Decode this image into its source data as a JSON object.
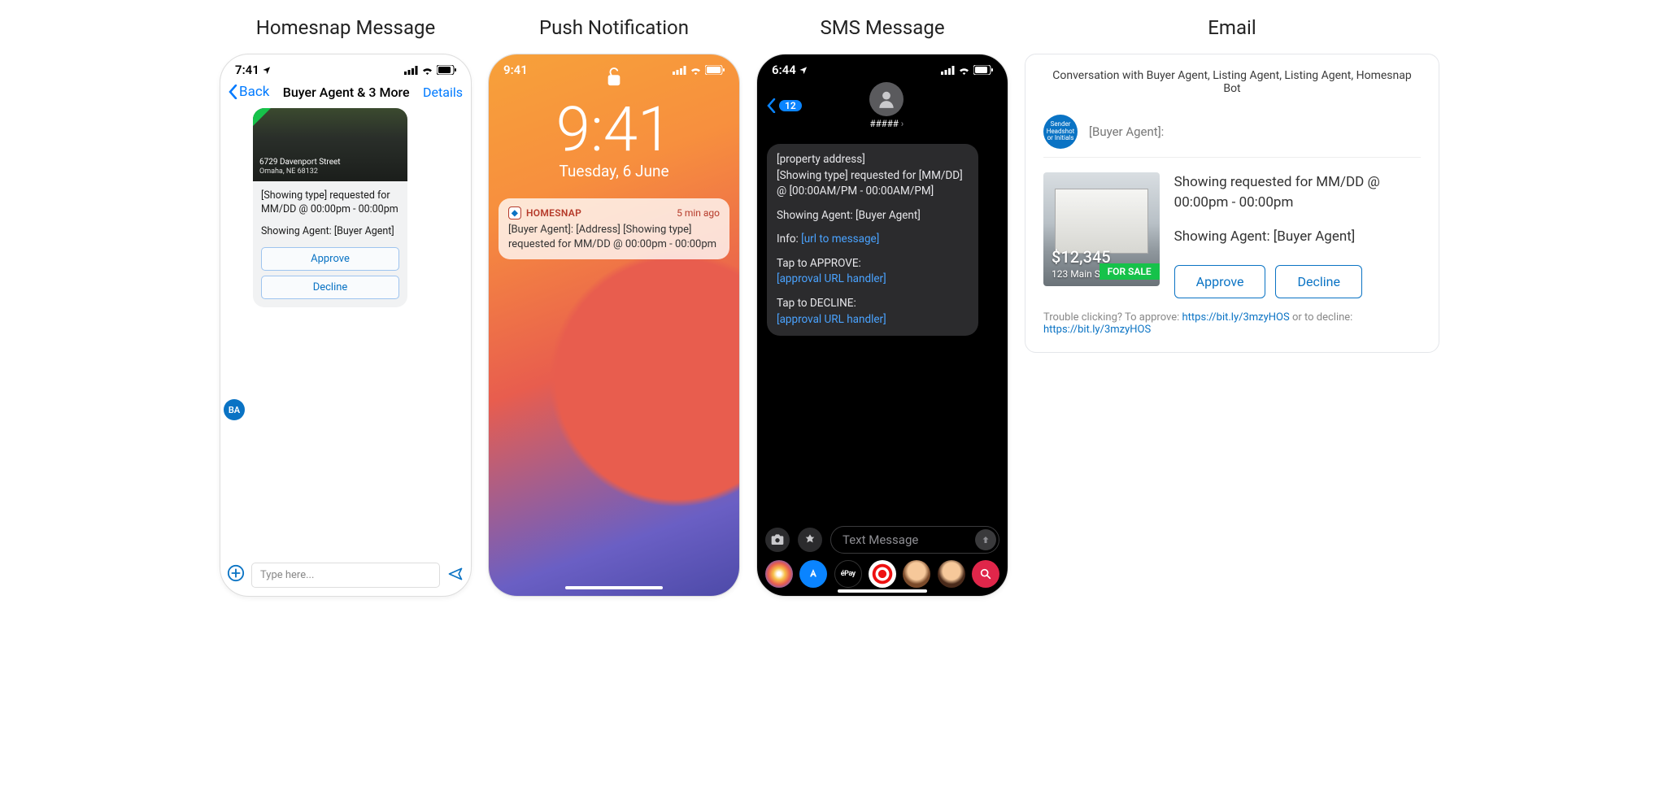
{
  "headings": {
    "homesnap": "Homesnap Message",
    "push": "Push Notification",
    "sms": "SMS Message",
    "email": "Email"
  },
  "homesnap": {
    "status_time": "7:41",
    "back": "Back",
    "title": "Buyer Agent & 3 More",
    "details": "Details",
    "avatar": "BA",
    "property_line1": "6729 Davenport Street",
    "property_line2": "Omaha, NE 68132",
    "body1": "[Showing type] requested for MM/DD @ 00:00pm - 00:00pm",
    "body2": "Showing Agent: [Buyer Agent]",
    "approve": "Approve",
    "decline": "Decline",
    "input_placeholder": "Type here..."
  },
  "push": {
    "status_time": "9:41",
    "big_time": "9:41",
    "big_date": "Tuesday, 6 June",
    "app_name": "HOMESNAP",
    "ago": "5 min ago",
    "body": "[Buyer Agent]: [Address] [Showing type] requested for MM/DD @ 00:00pm - 00:00pm"
  },
  "sms": {
    "status_time": "6:44",
    "back_badge": "12",
    "contact": "#####",
    "line1": "[property address]",
    "line2": "[Showing type] requested for [MM/DD] @ [00:00AM/PM - 00:00AM/PM]",
    "line3": "Showing Agent: [Buyer Agent]",
    "info_label": "Info: ",
    "info_link": "[url to message]",
    "approve_label": "Tap to APPROVE:",
    "approve_link": "[approval URL handler]",
    "decline_label": "Tap to DECLINE:",
    "decline_link": "[approval URL handler]",
    "input_placeholder": "Text Message",
    "apple_pay": "éPay"
  },
  "email": {
    "conversation": "Conversation with Buyer Agent, Listing Agent, Listing Agent, Homesnap Bot",
    "sender_circle": "Sender Headshot or Initials",
    "sender_name": "[Buyer Agent]:",
    "price": "$12,345",
    "addr": "123 Main St",
    "forsale": "FOR SALE",
    "line1": "Showing requested for MM/DD @ 00:00pm - 00:00pm",
    "line2": "Showing Agent: [Buyer Agent]",
    "approve": "Approve",
    "decline": "Decline",
    "foot_pre": "Trouble clicking?  To approve: ",
    "foot_link1": "https://bit.ly/3mzyHOS",
    "foot_mid": " or to decline: ",
    "foot_link2": "https://bit.ly/3mzyHOS"
  }
}
